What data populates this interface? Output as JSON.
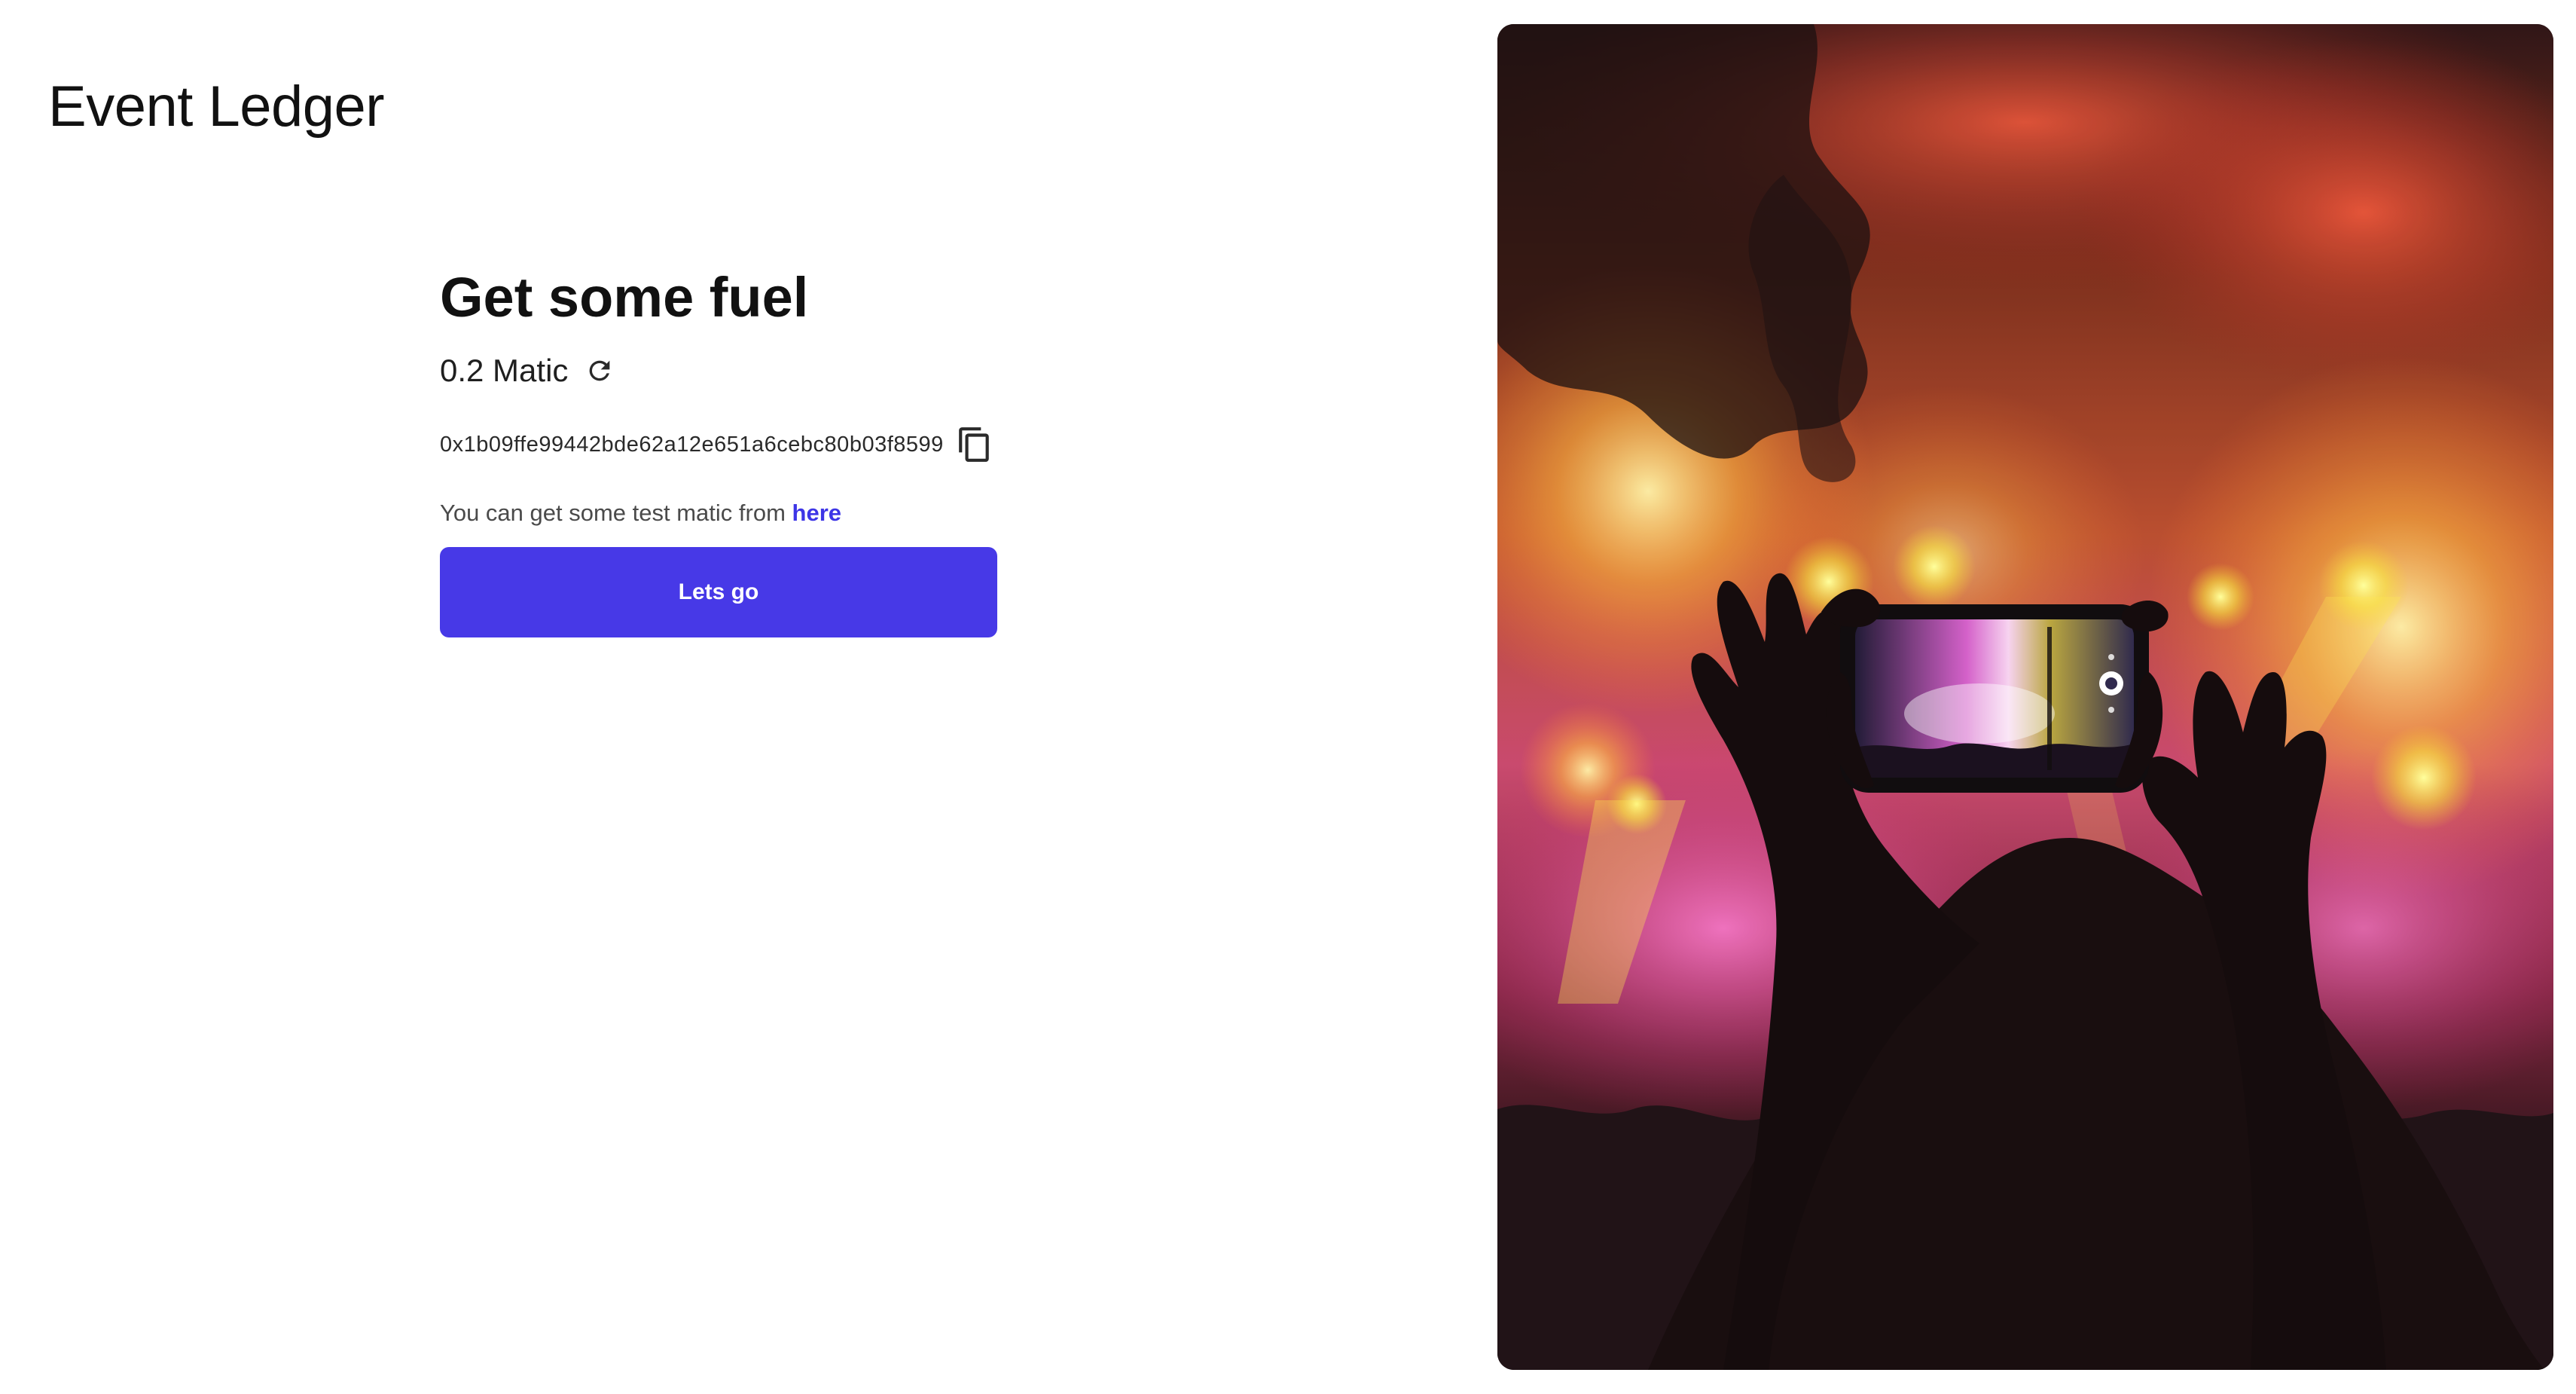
{
  "app": {
    "title": "Event Ledger"
  },
  "fuel": {
    "title": "Get some fuel",
    "balance": "0.2 Matic",
    "address": "0x1b09ffe99442bde62a12e651a6cebc80b03f8599",
    "hint_text": "You can get some test matic from ",
    "hint_link": "here",
    "cta_label": "Lets go"
  },
  "icons": {
    "refresh": "refresh-icon",
    "copy": "copy-icon"
  },
  "colors": {
    "accent": "#4739e7",
    "link": "#3d35e6",
    "text": "#111111"
  }
}
